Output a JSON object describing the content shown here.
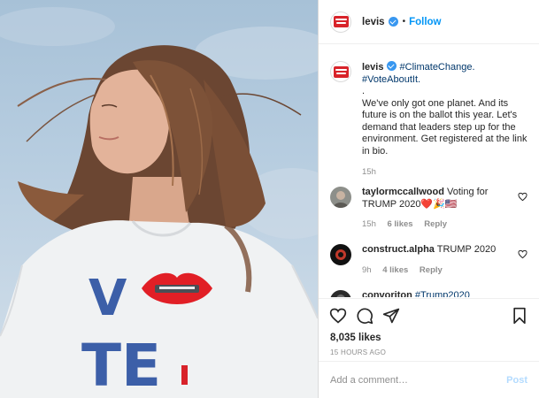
{
  "photo": {
    "shirt_text_top": "V",
    "shirt_text_bottom": "TE",
    "alt": "Woman in white VOTE t-shirt with wind-blown hair against blue sky"
  },
  "header": {
    "username": "levis",
    "separator": "•",
    "follow_label": "Follow"
  },
  "caption": {
    "username": "levis",
    "hashtag1": "#ClimateChange.",
    "hashtag2": "#VoteAboutIt.",
    "text": ".\nWe've only got one planet. And its future is on the ballot this year. Let's demand that leaders step up for the environment. Get registered at the link in bio.",
    "time": "15h"
  },
  "comments": [
    {
      "username": "taylormccallwood",
      "text": "Voting for TRUMP 2020❤️🎉🇺🇸",
      "time": "15h",
      "likes": "6 likes",
      "reply": "Reply"
    },
    {
      "username": "construct.alpha",
      "text": "TRUMP 2020",
      "time": "9h",
      "likes": "4 likes",
      "reply": "Reply"
    },
    {
      "username": "convoriton",
      "text": "#Trump2020"
    }
  ],
  "actions": {
    "likes": "8,035 likes",
    "time_ago": "15 HOURS AGO"
  },
  "add_comment": {
    "placeholder": "Add a comment…",
    "post_label": "Post"
  },
  "colors": {
    "link_blue": "#0095f6",
    "levis_red": "#d8232a",
    "vote_blue": "#3c5fa8"
  }
}
